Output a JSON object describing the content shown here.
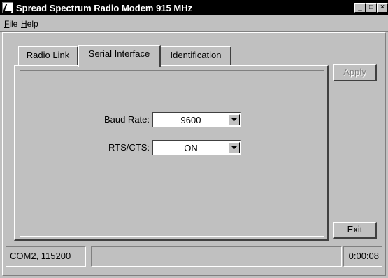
{
  "window": {
    "title": "Spread Spectrum Radio Modem 915 MHz"
  },
  "titlebar_buttons": {
    "minimize": "_",
    "maximize": "□",
    "close": "×"
  },
  "menu": {
    "file": {
      "mnemonic": "F",
      "rest": "ile"
    },
    "help": {
      "mnemonic": "H",
      "rest": "elp"
    }
  },
  "tabs": [
    {
      "label": "Radio Link"
    },
    {
      "label": "Serial Interface"
    },
    {
      "label": "Identification"
    }
  ],
  "active_tab": "Serial Interface",
  "form": {
    "baud_rate": {
      "label": "Baud Rate:",
      "value": "9600"
    },
    "rts_cts": {
      "label": "RTS/CTS:",
      "value": "ON"
    }
  },
  "buttons": {
    "apply": "Apply",
    "exit": "Exit"
  },
  "apply_enabled": false,
  "status": {
    "port": "COM2, 115200",
    "middle": "",
    "timer": "0:00:08"
  }
}
